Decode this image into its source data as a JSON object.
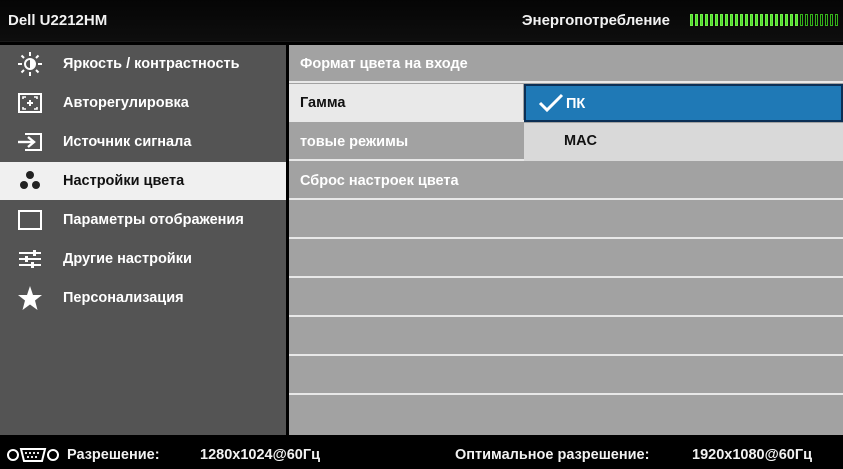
{
  "header": {
    "title": "Dell U2212HM",
    "power_label": "Энергопотребление",
    "power_level": 0.73
  },
  "sidebar": {
    "items": [
      {
        "label": "Яркость / контрастность",
        "icon": "brightness-icon"
      },
      {
        "label": "Авторегулировка",
        "icon": "auto-adjust-icon"
      },
      {
        "label": "Источник сигнала",
        "icon": "input-source-icon"
      },
      {
        "label": "Настройки цвета",
        "icon": "color-settings-icon",
        "active": true
      },
      {
        "label": "Параметры отображения",
        "icon": "display-settings-icon"
      },
      {
        "label": "Другие настройки",
        "icon": "other-settings-icon"
      },
      {
        "label": "Персонализация",
        "icon": "star-icon"
      }
    ]
  },
  "panel": {
    "rows": [
      {
        "label": "Формат цвета на входе"
      },
      {
        "label": "Гамма",
        "highlight": true
      },
      {
        "label": "товые режимы"
      },
      {
        "label": "Сброс настроек цвета"
      }
    ],
    "gamma_options": [
      {
        "label": "ПК",
        "selected": true
      },
      {
        "label": "MAC"
      }
    ]
  },
  "footer": {
    "resolution_label": "Разрешение:",
    "resolution_value": "1280x1024@60Гц",
    "optimal_label": "Оптимальное разрешение:",
    "optimal_value": "1920x1080@60Гц"
  },
  "colors": {
    "sidebar_bg": "#545454",
    "panel_bg": "#a2a2a2",
    "selected_option": "#1f79b6",
    "power_meter_green": "#4cd62a"
  }
}
